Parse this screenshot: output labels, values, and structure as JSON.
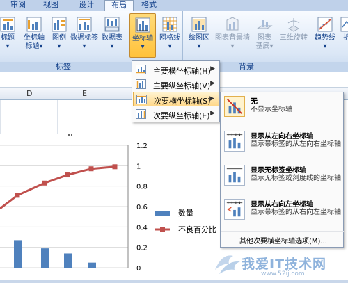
{
  "tabs": [
    {
      "label": "审阅"
    },
    {
      "label": "视图"
    },
    {
      "label": "设计"
    },
    {
      "label": "布局",
      "active": true
    },
    {
      "label": "格式"
    }
  ],
  "ribbon": {
    "labels_group": {
      "title": "标签",
      "buttons": [
        {
          "line1": "标题",
          "line2": "▾"
        },
        {
          "line1": "坐标轴",
          "line2": "标题▾"
        },
        {
          "line1": "图例",
          "line2": "▾"
        },
        {
          "line1": "数据标签",
          "line2": "▾"
        },
        {
          "line1": "数据表",
          "line2": "▾"
        }
      ]
    },
    "axes_group": {
      "buttons": [
        {
          "line1": "坐标轴",
          "line2": "▾"
        },
        {
          "line1": "网格线",
          "line2": "▾"
        }
      ]
    },
    "background_group": {
      "title": "背景",
      "buttons": [
        {
          "line1": "绘图区",
          "line2": "▾"
        },
        {
          "line1": "图表背景墙",
          "line2": "▾"
        },
        {
          "line1": "图表",
          "line2": "基底▾"
        },
        {
          "line1": "三维旋转",
          "line2": ""
        }
      ]
    },
    "analysis_group": {
      "buttons": [
        {
          "line1": "趋势线",
          "line2": "▾"
        },
        {
          "line1": "折",
          "line2": ""
        }
      ]
    }
  },
  "grid": {
    "columns": [
      "D",
      "E"
    ]
  },
  "chart_data": {
    "type": "bar",
    "categories": [
      "",
      "",
      "",
      "",
      ""
    ],
    "series": [
      {
        "name": "数量",
        "values": [
          0.27,
          0.19,
          0.14,
          0.05,
          0.0
        ]
      },
      {
        "name": "不良百分比",
        "type": "line",
        "values": [
          0.71,
          0.83,
          0.91,
          0.97,
          0.99
        ]
      }
    ],
    "y2_ticks": [
      "1.2",
      "1",
      "0.8",
      "0.6",
      "0.4",
      "0.2",
      "0"
    ],
    "ylim": [
      0,
      1.2
    ]
  },
  "menu": {
    "items": [
      {
        "label": "主要横坐标轴(H)",
        "arrow": "▶"
      },
      {
        "label": "主要纵坐标轴(V)",
        "arrow": "▶"
      },
      {
        "label": "次要横坐标轴(S)",
        "arrow": "▶",
        "highlighted": true
      },
      {
        "label": "次要纵坐标轴(E)",
        "arrow": "▶"
      }
    ]
  },
  "submenu": {
    "items": [
      {
        "title": "无",
        "desc": "不显示坐标轴"
      },
      {
        "title": "显示从左向右坐标轴",
        "desc": "显示带标签的从左向右坐标轴"
      },
      {
        "title": "显示无标签坐标轴",
        "desc": "显示无标签或刻度线的坐标轴"
      },
      {
        "title": "显示从右向左坐标轴",
        "desc": "显示带标签的从右向左坐标轴"
      }
    ],
    "footer": "其他次要横坐标轴选项(M)..."
  },
  "watermark": {
    "text": "我爱IT技术网",
    "url": "www.52ij.com"
  },
  "colors": {
    "bar": "#4f81bd",
    "line": "#c0504d",
    "menu_highlight": "#ffd88a"
  }
}
